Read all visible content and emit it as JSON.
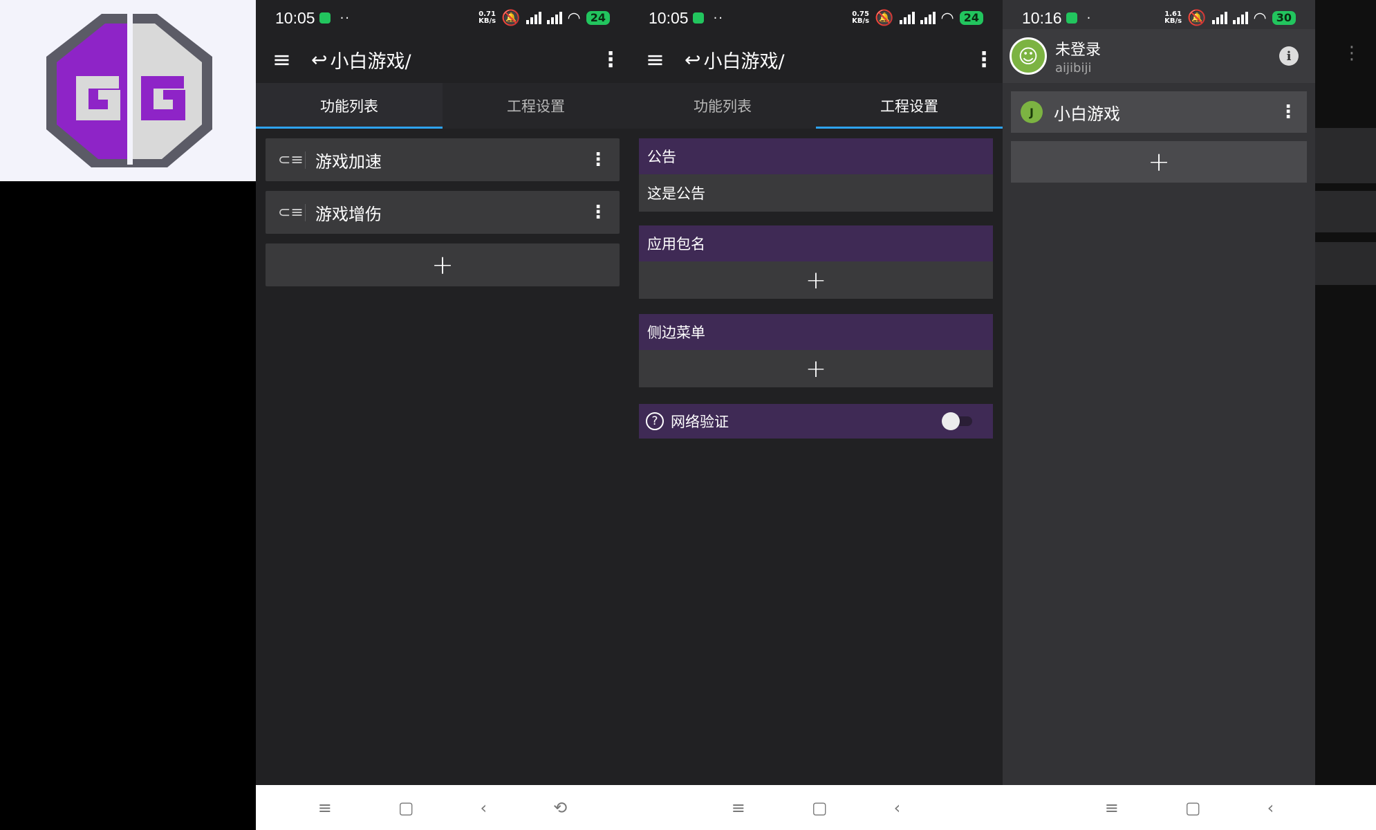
{
  "logo": {
    "letters": "GG",
    "colors": {
      "purple": "#8e24c7",
      "gray": "#d9d9d9",
      "dark": "#5b5b66"
    }
  },
  "screens": [
    {
      "status": {
        "time": "10:05",
        "speed_top": "0.71",
        "speed_unit": "KB/s",
        "battery": "24"
      },
      "appbar": {
        "title": "小白游戏/"
      },
      "tabs": [
        {
          "label": "功能列表"
        },
        {
          "label": "工程设置"
        }
      ],
      "functions": [
        {
          "label": "游戏加速"
        },
        {
          "label": "游戏增伤"
        }
      ],
      "add_label": "+"
    },
    {
      "status": {
        "time": "10:05",
        "speed_top": "0.75",
        "speed_unit": "KB/s",
        "battery": "24"
      },
      "appbar": {
        "title": "小白游戏/"
      },
      "tabs": [
        {
          "label": "功能列表"
        },
        {
          "label": "工程设置"
        }
      ],
      "sections": [
        {
          "title": "公告",
          "body": "这是公告"
        },
        {
          "title": "应用包名",
          "body": "+"
        },
        {
          "title": "侧边菜单",
          "body": "+"
        }
      ],
      "network": {
        "label": "网络验证",
        "enabled": false
      }
    },
    {
      "status": {
        "time": "10:16",
        "speed_top": "1.61",
        "speed_unit": "KB/s",
        "battery": "30"
      },
      "drawer": {
        "user_name": "未登录",
        "user_id": "aijibiji",
        "projects": [
          {
            "name": "小白游戏"
          }
        ],
        "add_label": "+"
      }
    }
  ],
  "colors": {
    "accent": "#2ea3f2",
    "section_purple": "#3f2a55",
    "battery_green": "#22c55e"
  }
}
